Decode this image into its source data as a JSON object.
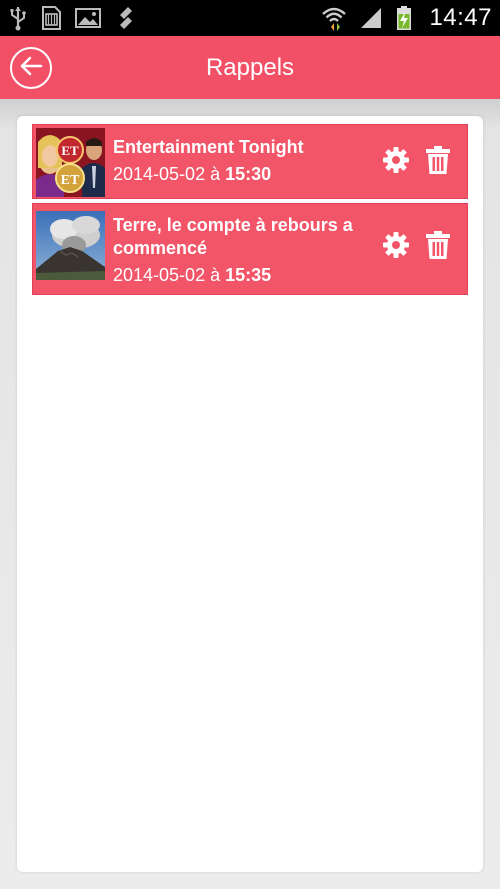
{
  "status_bar": {
    "time": "14:47",
    "icons": [
      "usb-icon",
      "sd-card-icon",
      "image-icon",
      "sync-icon",
      "wifi-icon",
      "signal-icon",
      "battery-charging-icon"
    ]
  },
  "header": {
    "title": "Rappels",
    "back_icon": "arrow-left-icon",
    "background": "#f15067"
  },
  "reminders": [
    {
      "title": "Entertainment Tonight",
      "date": "2014-05-02",
      "separator": " à ",
      "time": "15:30",
      "thumbnail": "entertainment-tonight-thumbnail"
    },
    {
      "title": "Terre, le compte à rebours a commencé",
      "date": "2014-05-02",
      "separator": " à ",
      "time": "15:35",
      "thumbnail": "volcano-thumbnail"
    }
  ],
  "colors": {
    "accent": "#f25468",
    "text_on_accent": "#ffffff"
  }
}
